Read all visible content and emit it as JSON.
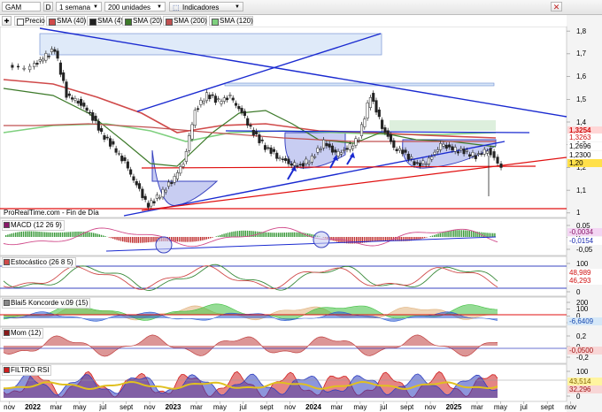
{
  "toolbar": {
    "symbol": "GAM",
    "period": "1 semana",
    "units": "200 unidades",
    "indicators_label": "Indicadores",
    "info_label": "D"
  },
  "legend": [
    {
      "label": "Precio",
      "color": "#ffffff"
    },
    {
      "label": "SMA (40)",
      "color": "#d04a4a"
    },
    {
      "label": "SMA (4)",
      "color": "#202020"
    },
    {
      "label": "SMA (20)",
      "color": "#3d7a2a"
    },
    {
      "label": "SMA (200)",
      "color": "#c05050"
    },
    {
      "label": "SMA (120)",
      "color": "#7fd07f"
    }
  ],
  "source_text": "ProRealTime.com - Fin de Día",
  "panels": {
    "macd": {
      "title": "MACD (12 26 9)",
      "color": "#8a1a6a"
    },
    "stoch": {
      "title": "Estocástico (26 8 5)",
      "color": "#d04a4a"
    },
    "blai5": {
      "title": "Blai5 Koncorde v.09 (15)",
      "color": "#888888"
    },
    "mom": {
      "title": "Mom (12)",
      "color": "#8a1a1a"
    },
    "rsi": {
      "title": "FILTRO RSI",
      "color": "#d02020"
    }
  },
  "price_labels": [
    {
      "text": "1,3254",
      "bg": "#ffffff",
      "fg": "#d01010"
    },
    {
      "text": "1,3263",
      "bg": "#ffffff",
      "fg": "#d01010"
    },
    {
      "text": "1,2696",
      "bg": "#ffffff",
      "fg": "#000000"
    },
    {
      "text": "1,2300",
      "bg": "#ffffff",
      "fg": "#000000"
    },
    {
      "text": "1,20",
      "bg": "#ffe04a",
      "fg": "#000000"
    }
  ],
  "indicator_labels": [
    {
      "text": "-0,0034",
      "bg": "#f3d6f3",
      "fg": "#8a1a6a"
    },
    {
      "text": "-0,0154",
      "bg": "#ffffff",
      "fg": "#1a2ab0"
    },
    {
      "text": "48,989",
      "bg": "#ffffff",
      "fg": "#d01010"
    },
    {
      "text": "46,293",
      "bg": "#ffffff",
      "fg": "#d01010"
    },
    {
      "text": "-6,6409",
      "bg": "#d6e8f8",
      "fg": "#1a4ab0"
    },
    {
      "text": "-0,0500",
      "bg": "#f8d6d6",
      "fg": "#a01010"
    },
    {
      "text": "43,514",
      "bg": "#fff4a0",
      "fg": "#806000"
    },
    {
      "text": "32,296",
      "bg": "#f8d6d6",
      "fg": "#a01010"
    }
  ],
  "chart_data": {
    "type": "line",
    "title": "GAM",
    "price_axis": {
      "ticks": [
        "1,8",
        "1,7",
        "1,6",
        "1,5",
        "1,4",
        "1,3",
        "1,2",
        "1,1",
        "1"
      ],
      "ylim": [
        0.98,
        1.82
      ]
    },
    "x_tick_labels": [
      "nov",
      "2022",
      "mar",
      "may",
      "jul",
      "sept",
      "nov",
      "2023",
      "mar",
      "may",
      "jul",
      "sept",
      "nov",
      "2024",
      "mar",
      "may",
      "jul",
      "sept",
      "nov",
      "2025",
      "mar",
      "may",
      "jul",
      "sept",
      "nov"
    ],
    "price_series": {
      "name": "Precio",
      "dates": [
        "2021-11",
        "2022-01",
        "2022-02",
        "2022-03",
        "2022-04",
        "2022-05",
        "2022-06",
        "2022-07",
        "2022-08",
        "2022-09",
        "2022-10",
        "2022-11",
        "2022-12",
        "2023-01",
        "2023-02",
        "2023-03",
        "2023-04",
        "2023-05",
        "2023-06",
        "2023-07",
        "2023-08",
        "2023-09",
        "2023-10",
        "2023-11",
        "2023-12",
        "2024-01",
        "2024-02",
        "2024-03",
        "2024-04",
        "2024-05",
        "2024-06",
        "2024-07",
        "2024-08",
        "2024-09",
        "2024-10",
        "2024-11",
        "2024-12",
        "2025-01",
        "2025-02",
        "2025-03",
        "2025-04"
      ],
      "values": [
        1.64,
        1.68,
        1.72,
        1.52,
        1.49,
        1.44,
        1.35,
        1.29,
        1.22,
        1.12,
        1.03,
        1.08,
        1.14,
        1.22,
        1.45,
        1.52,
        1.49,
        1.51,
        1.44,
        1.35,
        1.29,
        1.25,
        1.22,
        1.21,
        1.24,
        1.31,
        1.26,
        1.28,
        1.33,
        1.52,
        1.38,
        1.29,
        1.26,
        1.21,
        1.23,
        1.3,
        1.28,
        1.27,
        1.25,
        1.28,
        1.2
      ]
    },
    "tick_axes": {
      "macd": [
        "0,05",
        "0",
        "-0,05"
      ],
      "stoch": [
        "100",
        "0"
      ],
      "blai5": [
        "200",
        "100",
        "0",
        "-100"
      ],
      "mom": [
        "0,2",
        "0",
        "-0,2"
      ],
      "rsi": [
        "100",
        "0"
      ]
    }
  }
}
